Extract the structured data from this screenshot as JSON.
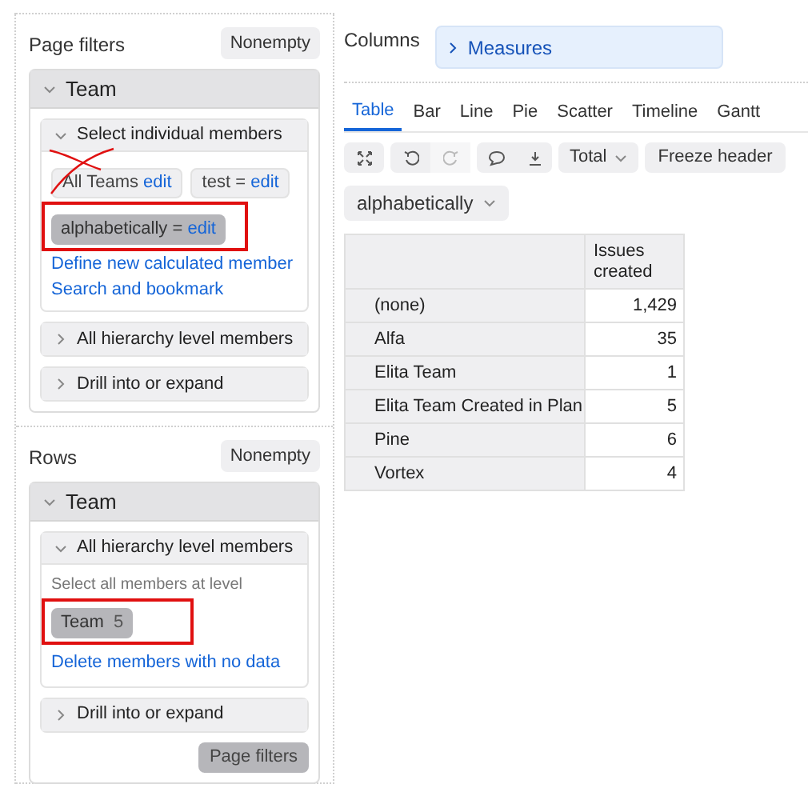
{
  "left": {
    "page_filters": {
      "title": "Page filters",
      "nonempty_button": "Nonempty",
      "dimension": {
        "title": "Team",
        "expanded": true,
        "sections": [
          {
            "title": "Select individual members",
            "expanded": true,
            "chips": [
              {
                "label": "All Teams",
                "edit": "edit",
                "selected": false
              },
              {
                "label": "test =",
                "edit": "edit",
                "selected": false
              },
              {
                "label": "alphabetically =",
                "edit": "edit",
                "selected": true
              }
            ],
            "links": [
              "Define new calculated member",
              "Search and bookmark"
            ]
          },
          {
            "title": "All hierarchy level members",
            "expanded": false
          },
          {
            "title": "Drill into or expand",
            "expanded": false
          }
        ]
      }
    },
    "rows": {
      "title": "Rows",
      "nonempty_button": "Nonempty",
      "dimension": {
        "title": "Team",
        "expanded": true,
        "sections": [
          {
            "title": "All hierarchy level members",
            "expanded": true,
            "hint": "Select all members at level",
            "level_chip": {
              "label": "Team",
              "count": "5"
            },
            "links": [
              "Delete members with no data"
            ]
          },
          {
            "title": "Drill into or expand",
            "expanded": false
          }
        ]
      },
      "footer_button": "Page filters"
    }
  },
  "columns": {
    "title": "Columns",
    "items": [
      "Measures"
    ]
  },
  "view_tabs": [
    {
      "label": "Table",
      "selected": true
    },
    {
      "label": "Bar",
      "selected": false
    },
    {
      "label": "Line",
      "selected": false
    },
    {
      "label": "Pie",
      "selected": false
    },
    {
      "label": "Scatter",
      "selected": false
    },
    {
      "label": "Timeline",
      "selected": false
    },
    {
      "label": "Gantt",
      "selected": false
    }
  ],
  "toolbar": {
    "total_dropdown": "Total",
    "freeze_button": "Freeze header",
    "order_dropdown": "alphabetically"
  },
  "table": {
    "header": "Issues created",
    "rows": [
      {
        "name": "(none)",
        "value": "1,429"
      },
      {
        "name": "Alfa",
        "value": "35"
      },
      {
        "name": "Elita Team",
        "value": "1"
      },
      {
        "name": "Elita Team Created in Plan",
        "value": "5"
      },
      {
        "name": "Pine",
        "value": "6"
      },
      {
        "name": "Vortex",
        "value": "4"
      }
    ]
  }
}
